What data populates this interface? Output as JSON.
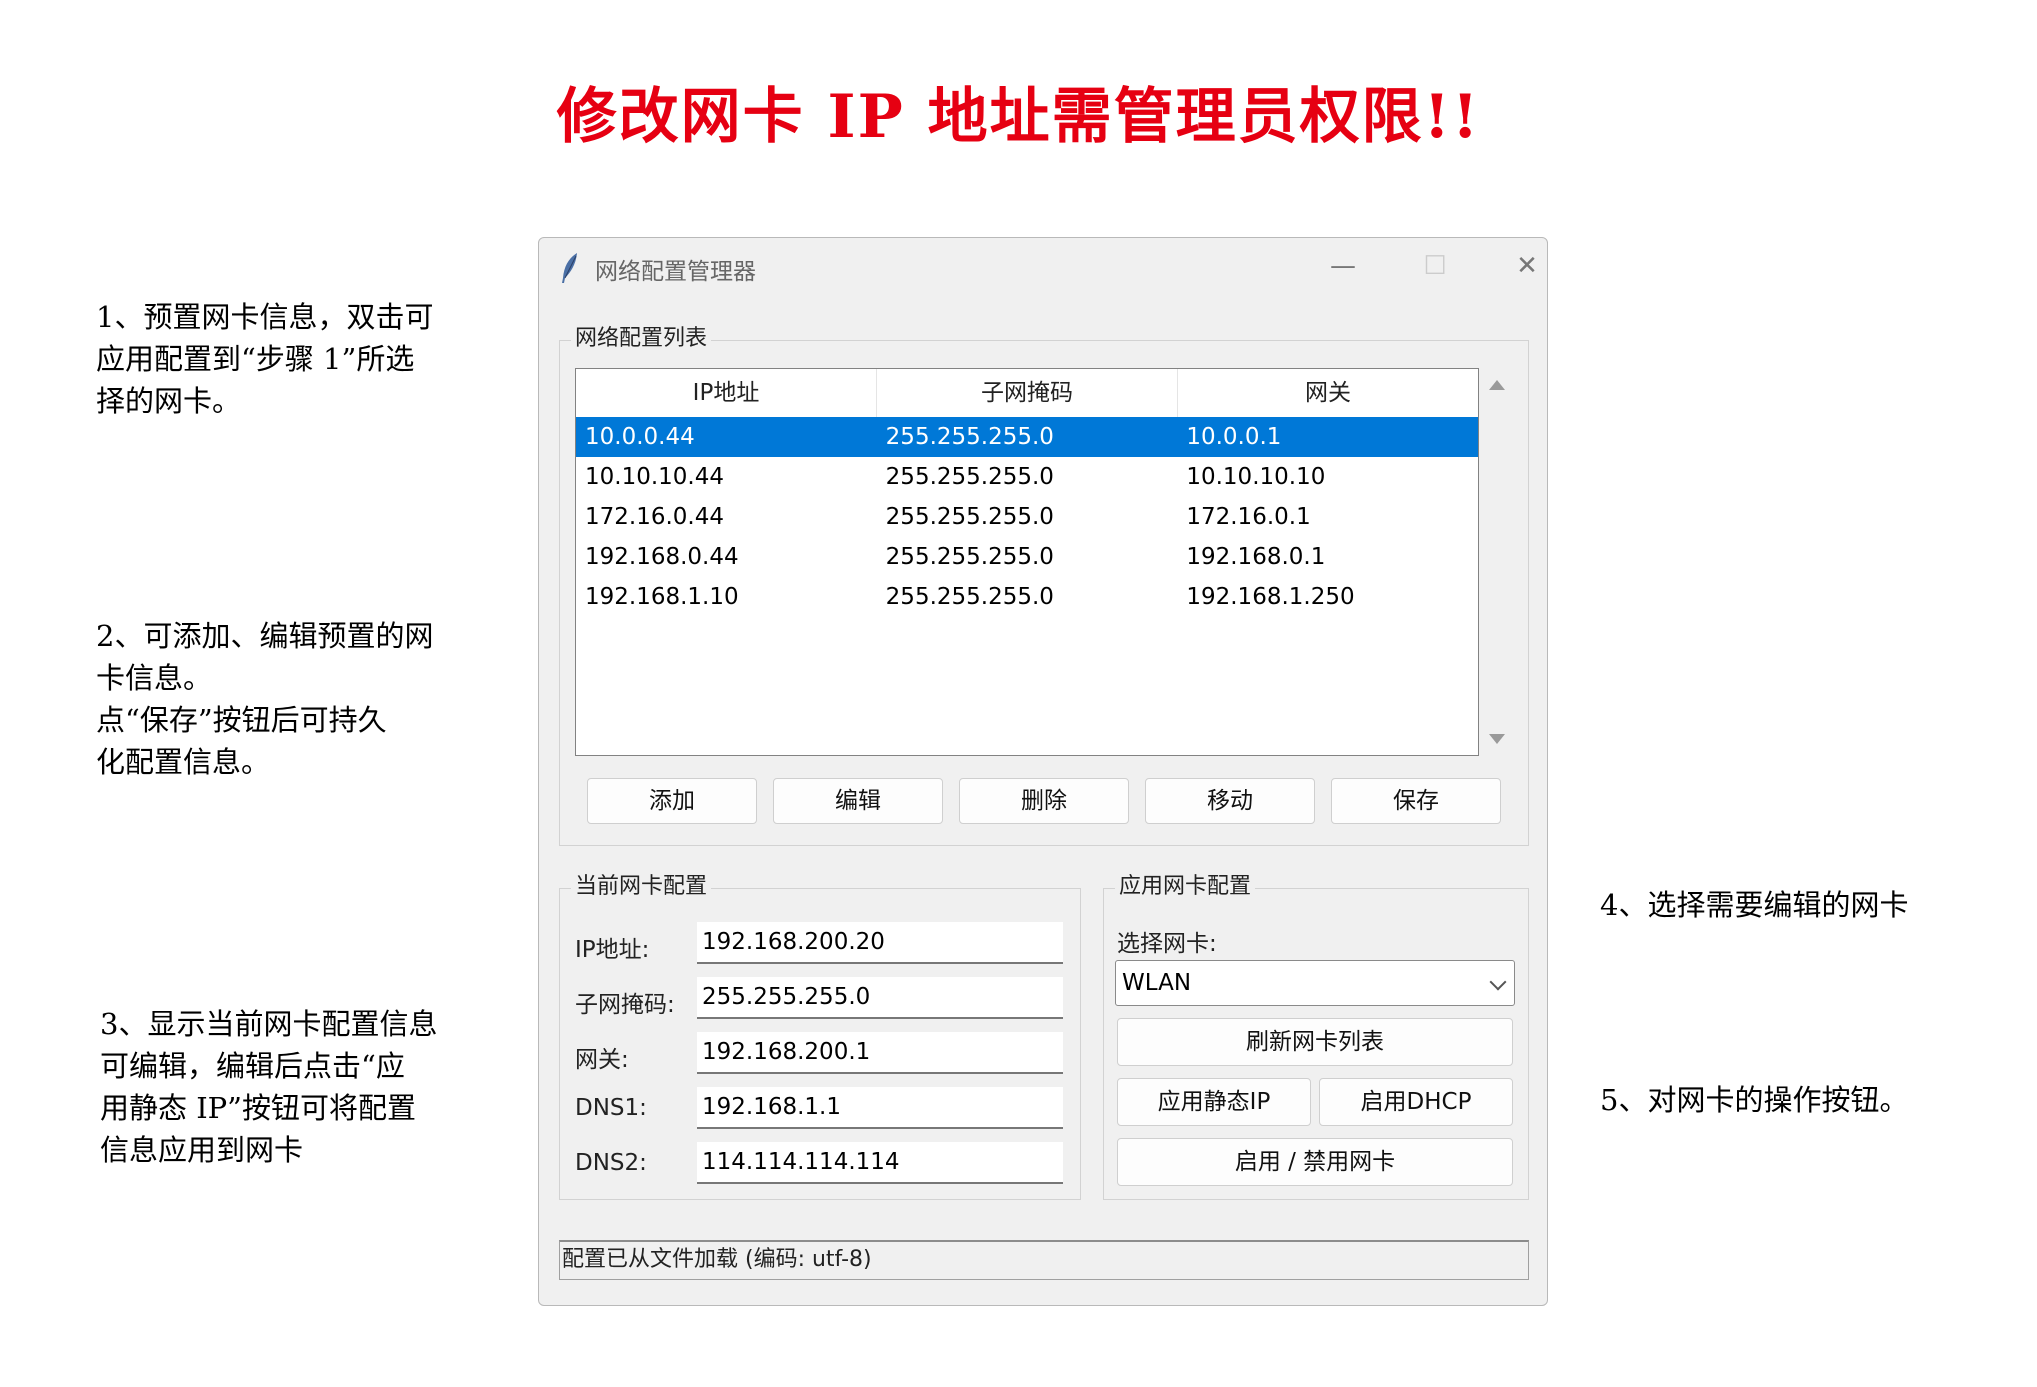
{
  "page_title": "修改网卡 IP 地址需管理员权限!!",
  "notes": {
    "n1": [
      "1、预置网卡信息，双击可",
      "应用配置到“步骤 1”所选",
      "择的网卡。"
    ],
    "n2": [
      "2、可添加、编辑预置的网",
      "卡信息。",
      "点“保存”按钮后可持久",
      "化配置信息。"
    ],
    "n3": [
      "3、显示当前网卡配置信息",
      "可编辑，编辑后点击“应",
      "用静态 IP”按钮可将配置",
      "信息应用到网卡"
    ],
    "n4": "4、选择需要编辑的网卡",
    "n5": "5、对网卡的操作按钮。"
  },
  "window": {
    "title": "网络配置管理器",
    "controls": {
      "minimize": "—",
      "maximize": "☐",
      "close": "✕"
    }
  },
  "config_list": {
    "label": "网络配置列表",
    "columns": [
      "IP地址",
      "子网掩码",
      "网关"
    ],
    "rows": [
      [
        "10.0.0.44",
        "255.255.255.0",
        "10.0.0.1"
      ],
      [
        "10.10.10.44",
        "255.255.255.0",
        "10.10.10.10"
      ],
      [
        "172.16.0.44",
        "255.255.255.0",
        "172.16.0.1"
      ],
      [
        "192.168.0.44",
        "255.255.255.0",
        "192.168.0.1"
      ],
      [
        "192.168.1.10",
        "255.255.255.0",
        "192.168.1.250"
      ]
    ],
    "selected_row": 0,
    "buttons": [
      "添加",
      "编辑",
      "删除",
      "移动",
      "保存"
    ]
  },
  "current_config": {
    "label": "当前网卡配置",
    "fields": [
      {
        "label": "IP地址:",
        "value": "192.168.200.20"
      },
      {
        "label": "子网掩码:",
        "value": "255.255.255.0"
      },
      {
        "label": "网关:",
        "value": "192.168.200.1"
      },
      {
        "label": "DNS1:",
        "value": "192.168.1.1"
      },
      {
        "label": "DNS2:",
        "value": "114.114.114.114"
      }
    ]
  },
  "apply_config": {
    "label": "应用网卡配置",
    "select_label": "选择网卡:",
    "selected_adapter": "WLAN",
    "refresh_button": "刷新网卡列表",
    "static_ip_button": "应用静态IP",
    "dhcp_button": "启用DHCP",
    "toggle_button": "启用 / 禁用网卡"
  },
  "status_text": "配置已从文件加载 (编码: utf-8)",
  "colors": {
    "title_red": "#e60012",
    "selection_blue": "#0078d7"
  }
}
